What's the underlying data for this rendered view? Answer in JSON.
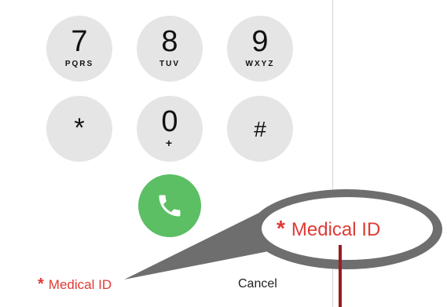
{
  "keypad": {
    "keys": [
      {
        "digit": "7",
        "letters": "PQRS"
      },
      {
        "digit": "8",
        "letters": "TUV"
      },
      {
        "digit": "9",
        "letters": "WXYZ"
      },
      {
        "digit": "*",
        "letters": ""
      },
      {
        "digit": "0",
        "letters": "+"
      },
      {
        "digit": "#",
        "letters": ""
      }
    ]
  },
  "call_button": {
    "icon": "phone-icon",
    "color": "#5cbf63"
  },
  "footer": {
    "medical_id_star": "*",
    "medical_id_label": "Medical ID",
    "cancel_label": "Cancel"
  },
  "callout": {
    "star": "*",
    "label": "Medical ID",
    "accent": "#e03a35"
  }
}
